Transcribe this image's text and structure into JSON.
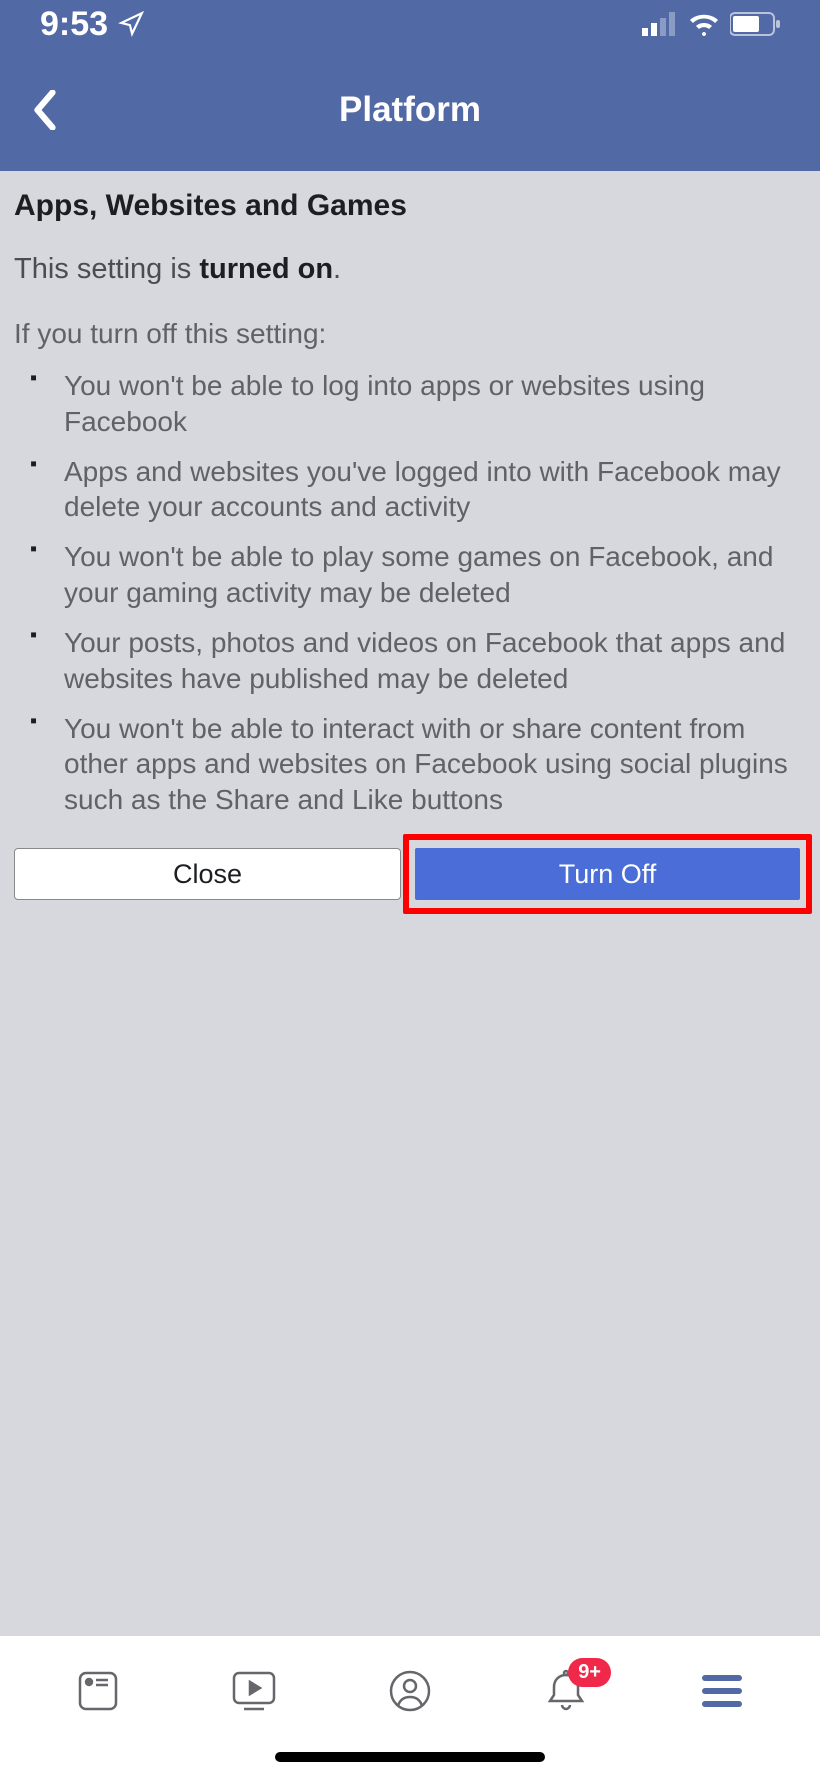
{
  "statusBar": {
    "time": "9:53"
  },
  "nav": {
    "title": "Platform"
  },
  "content": {
    "sectionTitle": "Apps, Websites and Games",
    "statusPrefix": "This setting is ",
    "statusBold": "turned on",
    "statusSuffix": ".",
    "introText": "If you turn off this setting:",
    "bullets": [
      "You won't be able to log into apps or websites using Facebook",
      "Apps and websites you've logged into with Facebook may delete your accounts and activity",
      "You won't be able to play some games on Facebook, and your gaming activity may be deleted",
      "Your posts, photos and videos on Facebook that apps and websites have published may be deleted",
      "You won't be able to interact with or share content from other apps and websites on Facebook using social plugins such as the Share and Like buttons"
    ],
    "closeLabel": "Close",
    "turnOffLabel": "Turn Off"
  },
  "bottomNav": {
    "badge": "9+"
  }
}
